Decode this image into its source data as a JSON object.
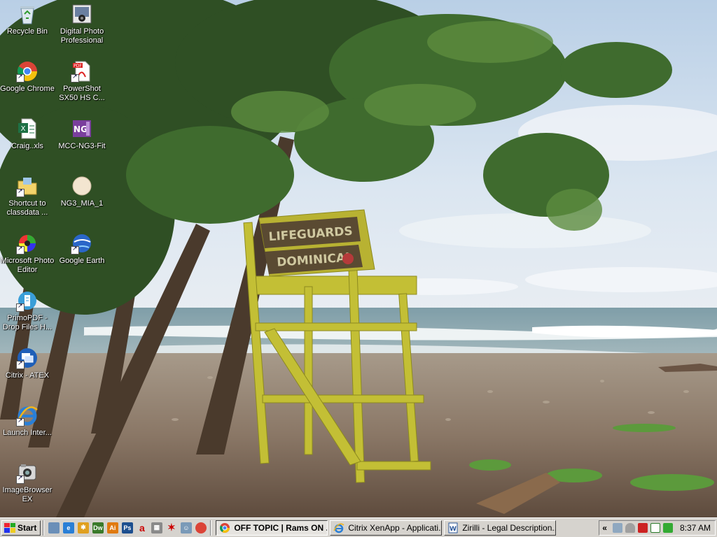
{
  "desktop": {
    "icons": [
      {
        "label": "Recycle Bin",
        "icon": "recycle-bin-icon"
      },
      {
        "label": "Digital Photo Professional",
        "icon": "camera-icon"
      },
      {
        "label": "Google Chrome",
        "icon": "chrome-icon"
      },
      {
        "label": "PowerShot SX50 HS C...",
        "icon": "pdf-icon"
      },
      {
        "label": "Craig..xls",
        "icon": "excel-icon"
      },
      {
        "label": "MCC-NG3-Fit",
        "icon": "onenote-icon"
      },
      {
        "label": "Shortcut to classdata ...",
        "icon": "folder-shortcut-icon"
      },
      {
        "label": "NG3_MIA_1",
        "icon": "image-file-icon"
      },
      {
        "label": "Microsoft Photo Editor",
        "icon": "photo-editor-icon"
      },
      {
        "label": "Google Earth",
        "icon": "google-earth-icon"
      },
      {
        "label": "PrimoPDF - Drop Files H...",
        "icon": "primopdf-icon"
      },
      {
        "label": "Citrix - ATEX",
        "icon": "citrix-icon"
      },
      {
        "label": "Launch Inter...",
        "icon": "internet-explorer-icon"
      },
      {
        "label": "ImageBrowser EX",
        "icon": "imagebrowser-icon"
      }
    ]
  },
  "wallpaper": {
    "sign_line1": "LIFEGUARDS",
    "sign_line2": "DOMINICAL"
  },
  "taskbar": {
    "start_label": "Start",
    "quick_launch": [
      "explorer-icon",
      "ie-icon",
      "settings-icon",
      "dreamweaver-icon",
      "illustrator-icon",
      "photoshop-icon",
      "acrobat-icon",
      "calculator-icon",
      "paint-icon",
      "messenger-icon",
      "chrome-icon"
    ],
    "tasks": [
      {
        "label": "OFF TOPIC | Rams ON ...",
        "icon": "chrome-icon",
        "active": true
      },
      {
        "label": "Citrix XenApp - Applicati...",
        "icon": "ie-icon",
        "active": false
      },
      {
        "label": "Zirilli - Legal Description....",
        "icon": "word-icon",
        "active": false
      }
    ],
    "tray": {
      "chevron": "«",
      "clock": "8:37 AM"
    }
  },
  "colors": {
    "taskbar_bg": "#d6d3ce",
    "sky": "#c9dcef",
    "ocean": "#8ea9b2",
    "sand": "#8a7a6a",
    "lifeguard_chair": "#c8c43a"
  }
}
